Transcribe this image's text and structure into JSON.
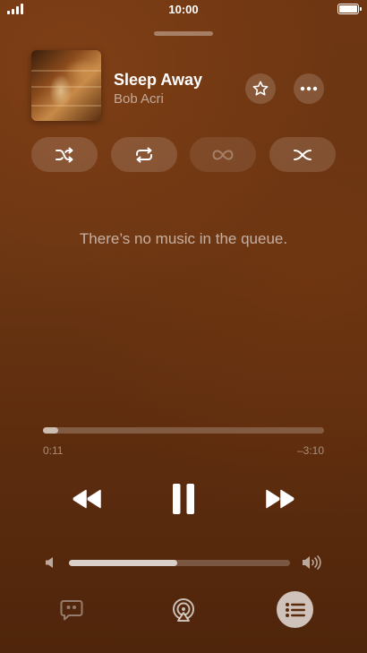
{
  "status_bar": {
    "time": "10:00"
  },
  "now_playing": {
    "title": "Sleep Away",
    "artist": "Bob Acri"
  },
  "queue": {
    "empty_message": "There’s no music in the queue.",
    "modes": [
      "shuffle",
      "repeat",
      "autoplay-infinity (disabled)",
      "crossfade"
    ]
  },
  "playback": {
    "elapsed": "0:11",
    "remaining": "–3:10",
    "progress_fraction": 0.055,
    "state": "playing"
  },
  "volume": {
    "level_fraction": 0.49
  },
  "bottom_bar": {
    "active_tab": "queue"
  },
  "colors": {
    "background": "#6a3512",
    "accent": "#ffffff"
  }
}
